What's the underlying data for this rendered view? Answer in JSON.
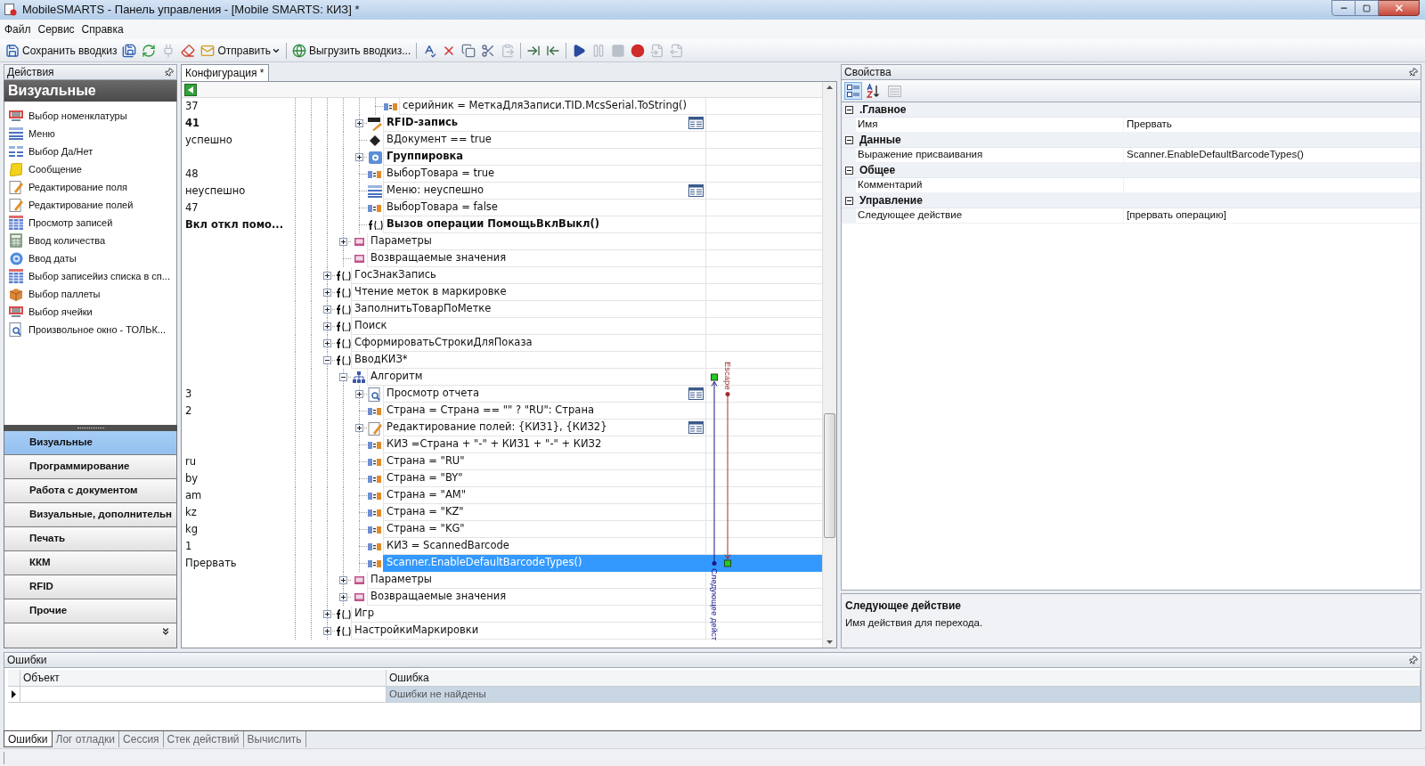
{
  "window": {
    "title": "MobileSMARTS - Панель управления - [Mobile SMARTS: КИЗ] *"
  },
  "menu": [
    "Файл",
    "Сервис",
    "Справка"
  ],
  "toolbar": [
    {
      "kind": "save",
      "label": "Сохранить вводкиз",
      "disabled": false
    },
    {
      "kind": "saveall",
      "disabled": false
    },
    {
      "kind": "refresh",
      "disabled": false
    },
    {
      "kind": "plug",
      "disabled": true
    },
    {
      "kind": "clear",
      "disabled": false
    },
    {
      "kind": "mail",
      "label": "Отправить",
      "dropdown": true,
      "disabled": false
    },
    {
      "kind": "separator"
    },
    {
      "kind": "globe",
      "label": "Выгрузить вводкиз...",
      "disabled": false
    },
    {
      "kind": "separator"
    },
    {
      "kind": "spellcheck",
      "disabled": false
    },
    {
      "kind": "delete",
      "disabled": false
    },
    {
      "kind": "copy",
      "disabled": false
    },
    {
      "kind": "cut",
      "disabled": false
    },
    {
      "kind": "paste",
      "disabled": true
    },
    {
      "kind": "separator"
    },
    {
      "kind": "indent",
      "disabled": false
    },
    {
      "kind": "outdent",
      "disabled": false
    },
    {
      "kind": "separator"
    },
    {
      "kind": "play",
      "disabled": false
    },
    {
      "kind": "pause",
      "disabled": true
    },
    {
      "kind": "stop",
      "disabled": true
    },
    {
      "kind": "record",
      "disabled": false
    },
    {
      "kind": "stepin",
      "disabled": true
    },
    {
      "kind": "stepout",
      "disabled": true
    }
  ],
  "actions": {
    "title": "Действия",
    "group_title": "Визуальные",
    "items": [
      {
        "label": "Выбор номенклатуры",
        "kind": "barcode"
      },
      {
        "label": "Меню",
        "kind": "menu"
      },
      {
        "label": "Выбор Да/Нет",
        "kind": "yesno"
      },
      {
        "label": "Сообщение",
        "kind": "message"
      },
      {
        "label": "Редактирование поля",
        "kind": "edit"
      },
      {
        "label": "Редактирование полей",
        "kind": "edit"
      },
      {
        "label": "Просмотр записей",
        "kind": "table"
      },
      {
        "label": "Ввод количества",
        "kind": "calculator"
      },
      {
        "label": "Ввод даты",
        "kind": "disc"
      },
      {
        "label": "Выбор записейиз списка в сп...",
        "kind": "table"
      },
      {
        "label": "Выбор паллеты",
        "kind": "box"
      },
      {
        "label": "Выбор ячейки",
        "kind": "barcode"
      },
      {
        "label": "Произвольное окно - ТОЛЬК...",
        "kind": "page"
      }
    ],
    "categories": [
      {
        "label": "Визуальные",
        "selected": true
      },
      {
        "label": "Программирование",
        "selected": false
      },
      {
        "label": "Работа с документом",
        "selected": false
      },
      {
        "label": "Визуальные, дополнительн",
        "selected": false
      },
      {
        "label": "Печать",
        "selected": false
      },
      {
        "label": "ККМ",
        "selected": false
      },
      {
        "label": "RFID",
        "selected": false
      },
      {
        "label": "Прочие",
        "selected": false
      }
    ]
  },
  "editor_tabs": [
    {
      "label": "Конфигурация *",
      "selected": true
    }
  ],
  "tree": [
    {
      "children": [
        {
          "children": [
            {
              "children": [
                {
                  "label": "серийник = МеткаДляЗаписи.TID.McsSerial.ToString()",
                  "note": "37",
                  "kind": "assign",
                  "selected": false
                }
              ]
            },
            {
              "label": "RFID-запись",
              "note": "41",
              "bold": true,
              "kind": "rfid",
              "expanded": false,
              "form": true,
              "selected": false
            },
            {
              "label": "ВДокумент == true",
              "note": "успешно",
              "kind": "condition",
              "selected": false
            },
            {
              "label": "Группировка",
              "bold": true,
              "kind": "group",
              "expanded": false,
              "selected": false
            },
            {
              "label": "ВыборТовара = true",
              "note": "48",
              "kind": "assign",
              "selected": false
            },
            {
              "label": "Меню: неуспешно",
              "note": "неуспешно",
              "kind": "menu",
              "form": true,
              "selected": false
            },
            {
              "label": "ВыборТовара = false",
              "note": "47",
              "kind": "assign",
              "selected": false
            },
            {
              "label": "Вызов операции ПомощьВклВыкл()",
              "note": "Вкл откл помо...",
              "bold": true,
              "kind": "function",
              "selected": false
            }
          ]
        },
        {
          "label": "Параметры",
          "kind": "params",
          "expanded": false,
          "selected": false
        },
        {
          "label": "Возвращаемые значения",
          "kind": "params",
          "selected": false
        }
      ]
    },
    {
      "label": "ГосЗнакЗапись",
      "kind": "function",
      "expanded": false,
      "selected": false
    },
    {
      "label": "Чтение меток в маркировке",
      "kind": "function",
      "expanded": false,
      "selected": false
    },
    {
      "label": "ЗаполнитьТоварПоМетке",
      "kind": "function",
      "expanded": false,
      "selected": false
    },
    {
      "label": "Поиск",
      "kind": "function",
      "expanded": false,
      "selected": false
    },
    {
      "label": "СформироватьСтрокиДляПоказа",
      "kind": "function",
      "expanded": false,
      "selected": false
    },
    {
      "label": "ВводКИЗ*",
      "kind": "function",
      "expanded": true,
      "selected": false,
      "children": [
        {
          "label": "Алгоритм",
          "kind": "algorithm",
          "expanded": true,
          "selected": false,
          "link_heads": [
            {
              "kind": "next"
            }
          ],
          "children": [
            {
              "label": "Просмотр отчета",
              "note": "3",
              "kind": "report",
              "expanded": false,
              "form": true,
              "selected": false,
              "link_tails": [
                {
                  "kind": "escape"
                }
              ]
            },
            {
              "label": "Страна = Страна == \"\" ? \"RU\": Страна",
              "note": "2",
              "kind": "assign",
              "selected": false
            },
            {
              "label": "Редактирование полей: {КИЗ1}, {КИЗ2}",
              "kind": "edit",
              "expanded": false,
              "form": true,
              "selected": false
            },
            {
              "label": "КИЗ =Страна + \"-\" + КИЗ1 + \"-\" + КИЗ2",
              "kind": "assign",
              "selected": false
            },
            {
              "label": "Страна = \"RU\"",
              "note": "ru",
              "kind": "assign",
              "selected": false
            },
            {
              "label": "Страна = \"BY\"",
              "note": "by",
              "kind": "assign",
              "selected": false
            },
            {
              "label": "Страна = \"AM\"",
              "note": "am",
              "kind": "assign",
              "selected": false
            },
            {
              "label": "Страна = \"KZ\"",
              "note": "kz",
              "kind": "assign",
              "selected": false
            },
            {
              "label": "Страна = \"KG\"",
              "note": "kg",
              "kind": "assign",
              "selected": false
            },
            {
              "label": "КИЗ = ScannedBarcode",
              "note": "1",
              "kind": "assign",
              "selected": false
            },
            {
              "label": "Scanner.EnableDefaultBarcodeTypes()",
              "note": "Прервать",
              "kind": "assign",
              "selected": true,
              "link_tails": [
                {
                  "kind": "next"
                }
              ],
              "link_heads": [
                {
                  "kind": "escape"
                }
              ]
            }
          ]
        },
        {
          "label": "Параметры",
          "kind": "params",
          "expanded": false,
          "selected": false
        },
        {
          "label": "Возвращаемые значения",
          "kind": "params",
          "expanded": false,
          "selected": false
        }
      ]
    },
    {
      "label": "Игр",
      "kind": "function",
      "expanded": false,
      "selected": false
    },
    {
      "label": "НастройкиМаркировки",
      "kind": "function",
      "expanded": false,
      "selected": false
    }
  ],
  "links": [
    {
      "kind": "next",
      "label": "Следующее дейст"
    },
    {
      "kind": "escape",
      "label": "Escape"
    }
  ],
  "properties": {
    "title": "Свойства",
    "tools": [
      {
        "kind": "categorized",
        "selected": true
      },
      {
        "kind": "alphabetical",
        "selected": false
      },
      {
        "kind": "pages",
        "disabled": true
      }
    ],
    "categories": [
      {
        "label": ".Главное",
        "expanded": true,
        "rows": [
          {
            "name": "Имя",
            "value": "Прервать"
          }
        ]
      },
      {
        "label": "Данные",
        "expanded": true,
        "rows": [
          {
            "name": "Выражение присваивания",
            "value": "Scanner.EnableDefaultBarcodeTypes()"
          }
        ]
      },
      {
        "label": "Общее",
        "expanded": true,
        "rows": [
          {
            "name": "Комментарий"
          }
        ]
      },
      {
        "label": "Управление",
        "expanded": true,
        "rows": [
          {
            "name": "Следующее действие",
            "value": "[прервать операцию]"
          }
        ]
      }
    ],
    "description": {
      "title": "Следующее действие",
      "text": "Имя действия для перехода."
    }
  },
  "errors": {
    "title": "Ошибки",
    "columns": [
      "Объект",
      "Ошибка"
    ],
    "rows": [
      {
        "error": "Ошибки не найдены",
        "current": true,
        "selected": true
      }
    ],
    "tabs": [
      {
        "label": "Ошибки",
        "selected": true
      },
      {
        "label": "Лог отладки",
        "selected": false
      },
      {
        "label": "Сессия",
        "selected": false
      },
      {
        "label": "Стек действий",
        "selected": false
      },
      {
        "label": "Вычислить",
        "selected": false
      }
    ]
  }
}
